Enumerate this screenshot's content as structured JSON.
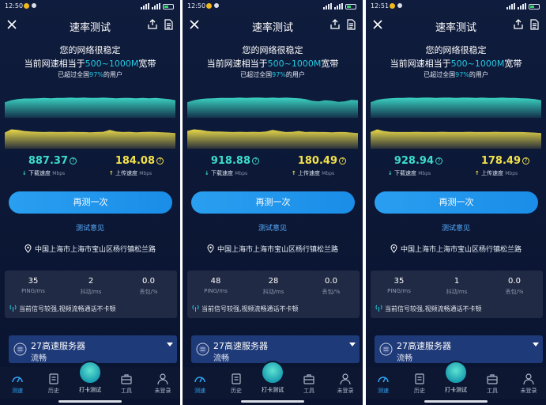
{
  "app": {
    "title": "速率测试",
    "headline": "您的网络很稳定",
    "compare_prefix": "当前网速相当于",
    "compare_value": "500~1000M",
    "compare_suffix": "宽带",
    "beat_prefix": "已超过全国",
    "beat_value": "97%",
    "beat_suffix": "的用户",
    "download_label": "下载速度",
    "upload_label": "上传速度",
    "unit": "Mbps",
    "retest_label": "再测一次",
    "feedback_label": "测试意见",
    "location": "中国上海市上海市宝山区杨行镇松兰路",
    "ping_label": "PING/ms",
    "jitter_label": "抖动/ms",
    "loss_label": "丢包/%",
    "signal_text": "当前信号较强,视频流畅通话不卡顿",
    "server_name": "27高速服务器",
    "server_state": "流畅",
    "tabs": {
      "speed": "测速",
      "history": "历史",
      "checkin": "打卡测试",
      "tools": "工具",
      "profile": "未登录"
    }
  },
  "colors": {
    "accent": "#25c7e0",
    "download": "#3ddcc8",
    "upload": "#f4e24a",
    "button": "#1a8de8"
  },
  "panels": [
    {
      "time": "12:50",
      "download": "887.37",
      "upload": "184.08",
      "ping": "35",
      "jitter": "2",
      "loss": "0.0",
      "download_wave": [
        0.55,
        0.62,
        0.66,
        0.68,
        0.68,
        0.69,
        0.7,
        0.69,
        0.7,
        0.7,
        0.71,
        0.7,
        0.71,
        0.7,
        0.7,
        0.71,
        0.7,
        0.69,
        0.7,
        0.7,
        0.69,
        0.7,
        0.69,
        0.7,
        0.68,
        0.66,
        0.62
      ],
      "upload_wave": [
        0.6,
        0.72,
        0.7,
        0.66,
        0.64,
        0.63,
        0.62,
        0.63,
        0.62,
        0.62,
        0.63,
        0.62,
        0.62,
        0.61,
        0.62,
        0.63,
        0.7,
        0.64,
        0.62,
        0.63,
        0.61,
        0.62,
        0.63,
        0.62,
        0.61,
        0.6,
        0.58
      ]
    },
    {
      "time": "12:50",
      "download": "918.88",
      "upload": "180.49",
      "ping": "48",
      "jitter": "28",
      "loss": "0.0",
      "download_wave": [
        0.55,
        0.62,
        0.66,
        0.68,
        0.69,
        0.7,
        0.7,
        0.7,
        0.71,
        0.7,
        0.71,
        0.71,
        0.7,
        0.71,
        0.7,
        0.71,
        0.7,
        0.69,
        0.66,
        0.6,
        0.58,
        0.62,
        0.6,
        0.56,
        0.58,
        0.63,
        0.62
      ],
      "upload_wave": [
        0.66,
        0.72,
        0.7,
        0.66,
        0.64,
        0.64,
        0.63,
        0.62,
        0.63,
        0.62,
        0.63,
        0.62,
        0.64,
        0.7,
        0.66,
        0.62,
        0.63,
        0.66,
        0.62,
        0.63,
        0.62,
        0.62,
        0.61,
        0.62,
        0.62,
        0.6,
        0.58
      ]
    },
    {
      "time": "12:51",
      "download": "928.94",
      "upload": "178.49",
      "ping": "35",
      "jitter": "1",
      "loss": "0.0",
      "download_wave": [
        0.55,
        0.63,
        0.67,
        0.69,
        0.7,
        0.7,
        0.71,
        0.7,
        0.71,
        0.71,
        0.7,
        0.71,
        0.71,
        0.7,
        0.71,
        0.71,
        0.7,
        0.71,
        0.7,
        0.7,
        0.71,
        0.7,
        0.7,
        0.69,
        0.68,
        0.66,
        0.62
      ],
      "upload_wave": [
        0.62,
        0.72,
        0.66,
        0.63,
        0.62,
        0.62,
        0.62,
        0.63,
        0.62,
        0.62,
        0.62,
        0.63,
        0.62,
        0.62,
        0.62,
        0.63,
        0.62,
        0.62,
        0.62,
        0.63,
        0.62,
        0.62,
        0.62,
        0.62,
        0.61,
        0.6,
        0.58
      ]
    }
  ]
}
